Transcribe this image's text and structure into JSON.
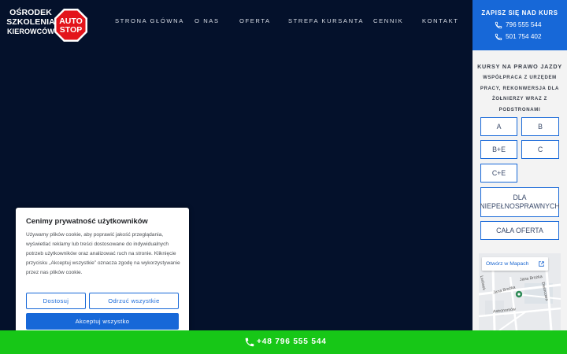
{
  "logo": {
    "lines": [
      "OŚRODEK",
      "SZKOLENIA",
      "KIEROWCÓW"
    ],
    "badge_line1": "AUTO",
    "badge_line2": "STOP",
    "badge_color": "#e3141b"
  },
  "nav": {
    "items": [
      "STRONA GŁÓWNA",
      "O NAS",
      "OFERTA",
      "STREFA KURSANTA",
      "CENNIK",
      "KONTAKT"
    ]
  },
  "signup": {
    "title": "ZAPISZ SIĘ NAD KURS",
    "phone1": "796 555 544",
    "phone2": "501 754 402",
    "icon": "phone-icon",
    "bg_color": "#1768d8"
  },
  "courses": {
    "title": "KURSY NA PRAWO JAZDY",
    "subtitle": "WSPÓŁPRACA Z URZĘDEM PRACY, REKONWERSJA DLA ŻOŁNIERZY WRAZ Z PODSTRONAMI",
    "categories": [
      "A",
      "B",
      "B+E",
      "C",
      "C+E"
    ],
    "disabled_label": "DLA NIEPEŁNOSPRAWNYCH",
    "all_offer_label": "CAŁA OFERTA"
  },
  "map": {
    "open_label": "Otwórz w Mapach",
    "streets": [
      "Lwówek",
      "Jana Brożka",
      "Jana Brożka",
      "Dworcowa",
      "Astronomów"
    ]
  },
  "cookie": {
    "title": "Cenimy prywatność użytkowników",
    "body": "Używamy plików cookie, aby poprawić jakość przeglądania, wyświetlać reklamy lub treści dostosowane do indywidualnych potrzeb użytkowników oraz analizować ruch na stronie. Kliknięcie przycisku „Akceptuj wszystkie” oznacza zgodę na wykorzystywanie przez nas plików cookie.",
    "customize_label": "Dostosuj",
    "reject_label": "Odrzuć wszystkie",
    "accept_label": "Akceptuj wszystko"
  },
  "callbar": {
    "phone": "+48 796 555 544",
    "bg_color": "#17c717"
  }
}
